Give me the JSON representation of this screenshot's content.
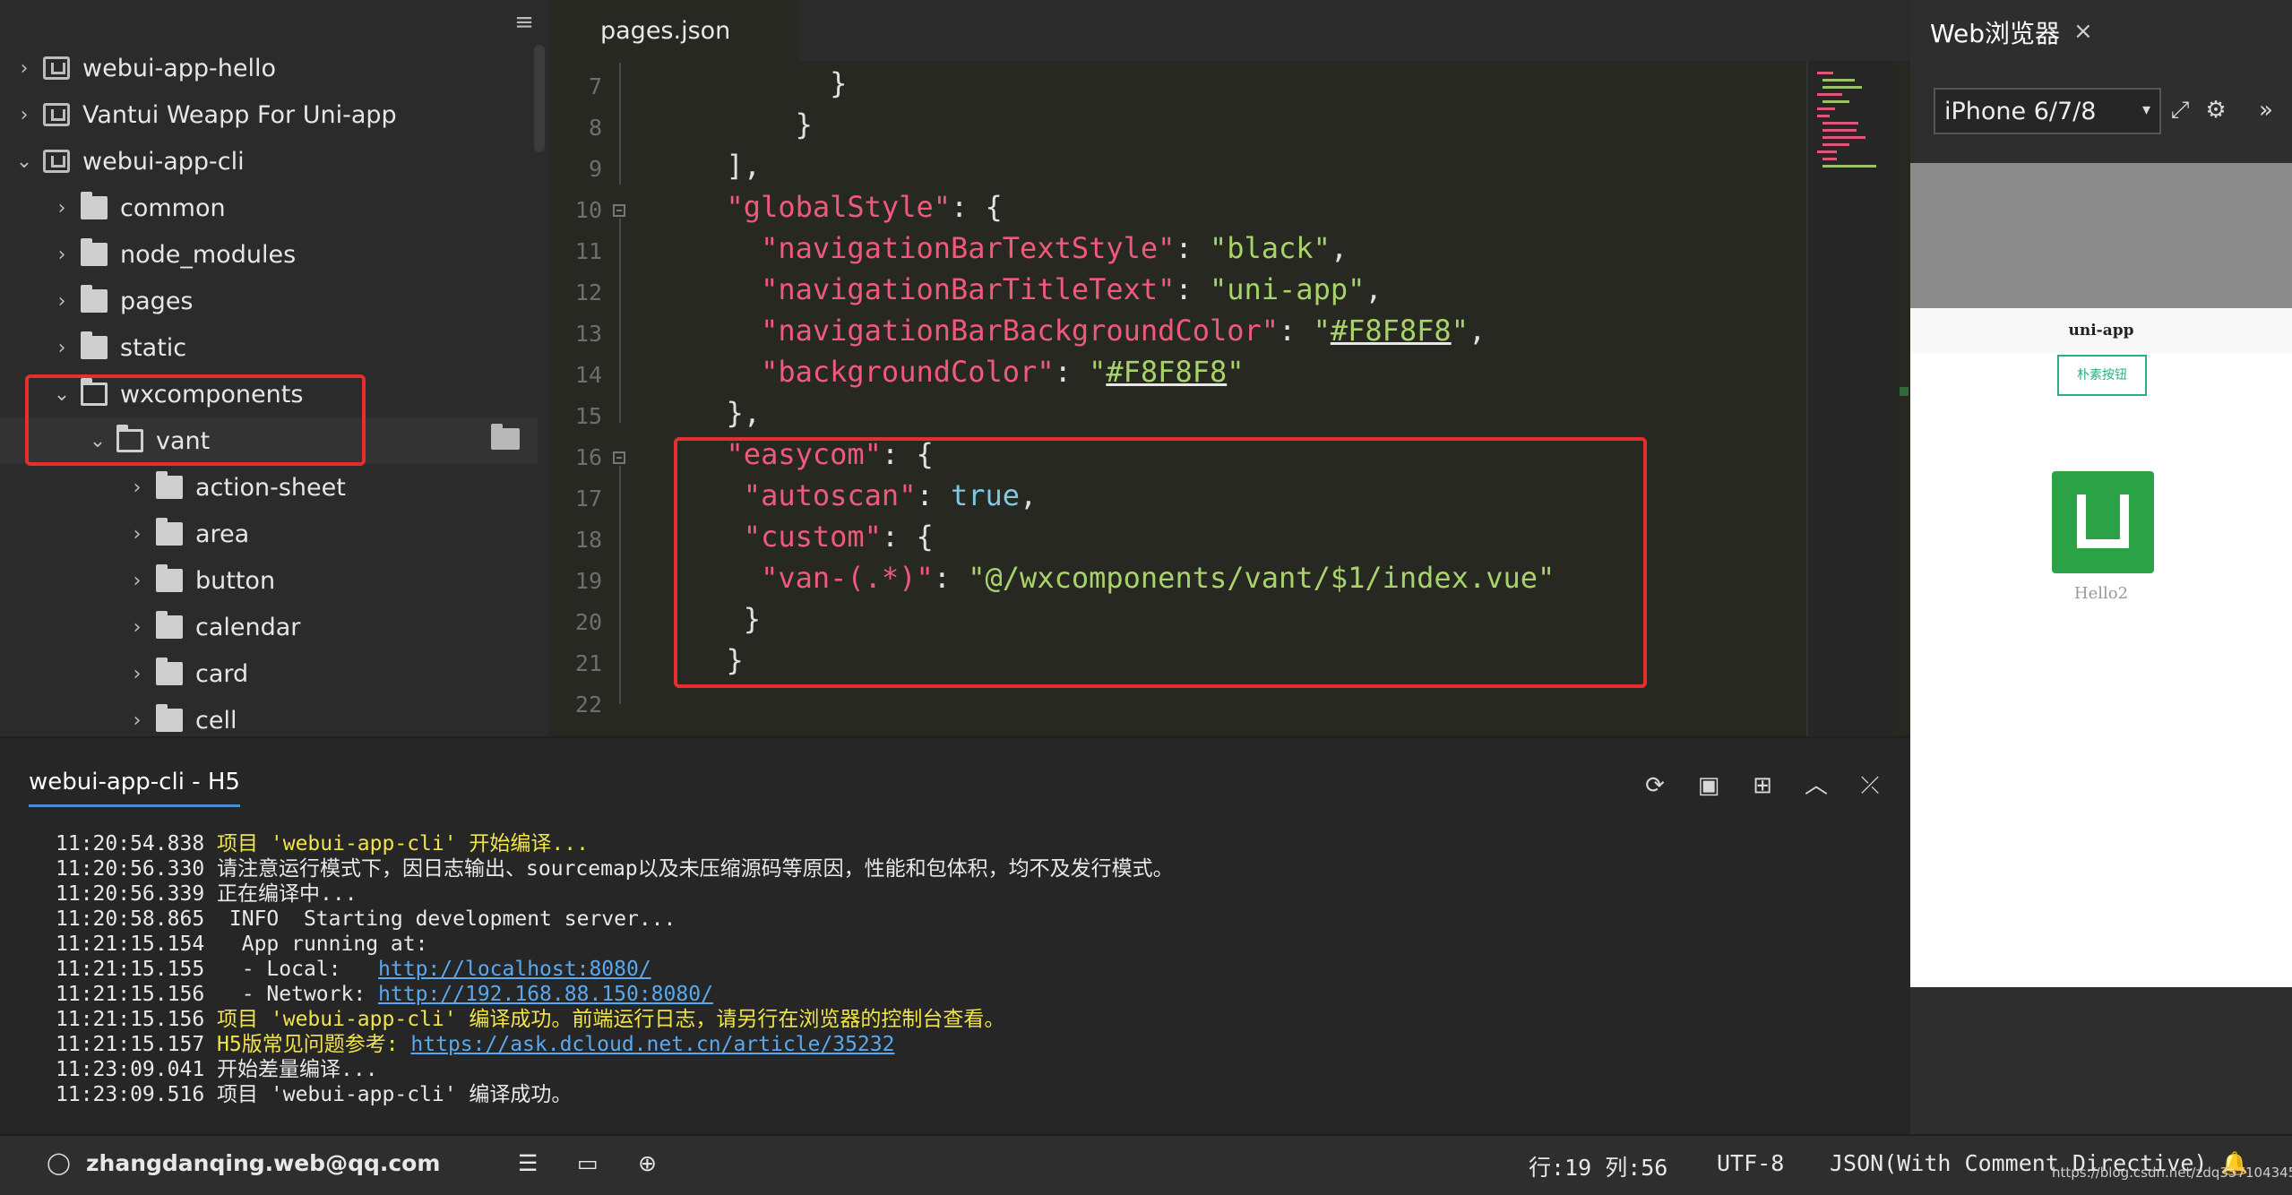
{
  "sidebar": {
    "projects": [
      {
        "label": "webui-app-hello",
        "expanded": false
      },
      {
        "label": "Vantui Weapp For Uni-app",
        "expanded": false
      },
      {
        "label": "webui-app-cli",
        "expanded": true
      }
    ],
    "folders": [
      "common",
      "node_modules",
      "pages",
      "static"
    ],
    "wxcomponents": "wxcomponents",
    "vant": "vant",
    "vant_children": [
      "action-sheet",
      "area",
      "button",
      "calendar",
      "card",
      "cell"
    ],
    "menu_icon": "hamburger-icon"
  },
  "editor": {
    "tab_title": "pages.json",
    "line_numbers": [
      "7",
      "8",
      "9",
      "10",
      "11",
      "12",
      "13",
      "14",
      "15",
      "16",
      "17",
      "18",
      "19",
      "20",
      "21",
      "22"
    ],
    "code": {
      "l7": "}",
      "l8": "}",
      "l9": "],",
      "l10_key": "\"globalStyle\"",
      "l10_rest": ": {",
      "l11_key": "\"navigationBarTextStyle\"",
      "l11_val": "\"black\"",
      "l12_key": "\"navigationBarTitleText\"",
      "l12_val": "\"uni-app\"",
      "l13_key": "\"navigationBarBackgroundColor\"",
      "l13_val_q1": "\"",
      "l13_val": "#F8F8F8",
      "l13_val_q2": "\"",
      "l14_key": "\"backgroundColor\"",
      "l14_val_q1": "\"",
      "l14_val": "#F8F8F8",
      "l14_val_q2": "\"",
      "l15": "},",
      "l16_key": "\"easycom\"",
      "l16_rest": ": {",
      "l17_key": "\"autoscan\"",
      "l17_val": "true",
      "l18_key": "\"custom\"",
      "l18_rest": ": {",
      "l19_key": "\"van-(.*)\"",
      "l19_val": "\"@/wxcomponents/vant/$1/index.vue\"",
      "l20": "}",
      "l21": "}"
    }
  },
  "browser": {
    "title": "Web浏览器",
    "close": "×",
    "device": "iPhone 6/7/8",
    "sim_nav_title": "uni-app",
    "sim_button": "朴素按钮",
    "sim_hello": "Hello2"
  },
  "console": {
    "tab": "webui-app-cli - H5",
    "logs": [
      {
        "time": "11:20:54.838",
        "msg": "项目 'webui-app-cli' 开始编译...",
        "type": "yellow"
      },
      {
        "time": "11:20:56.330",
        "msg": "请注意运行模式下，因日志输出、sourcemap以及未压缩源码等原因，性能和包体积，均不及发行模式。",
        "type": "normal"
      },
      {
        "time": "11:20:56.339",
        "msg": "正在编译中...",
        "type": "normal"
      },
      {
        "time": "11:20:58.865",
        "msg": " INFO  Starting development server...",
        "type": "normal"
      },
      {
        "time": "11:21:15.154",
        "msg": "  App running at:",
        "type": "normal"
      },
      {
        "time": "11:21:15.155",
        "msg": "  - Local:   ",
        "link": "http://localhost:8080/",
        "type": "link"
      },
      {
        "time": "11:21:15.156",
        "msg": "  - Network: ",
        "link": "http://192.168.88.150:8080/",
        "type": "link"
      },
      {
        "time": "11:21:15.156",
        "msg": "项目 'webui-app-cli' 编译成功。前端运行日志，请另行在浏览器的控制台查看。",
        "type": "yellow"
      },
      {
        "time": "11:21:15.157",
        "msg": "H5版常见问题参考: ",
        "link": "https://ask.dcloud.net.cn/article/35232",
        "type": "yellowlink"
      },
      {
        "time": "11:23:09.041",
        "msg": "开始差量编译...",
        "type": "normal"
      },
      {
        "time": "11:23:09.516",
        "msg": "项目 'webui-app-cli' 编译成功。",
        "type": "normal"
      }
    ]
  },
  "statusbar": {
    "user": "zhangdanqing.web@qq.com",
    "cursor": "行:19  列:56",
    "encoding": "UTF-8",
    "language": "JSON(With Comment Directive)",
    "watermark": "https://blog.csdn.net/zdq357104345"
  }
}
